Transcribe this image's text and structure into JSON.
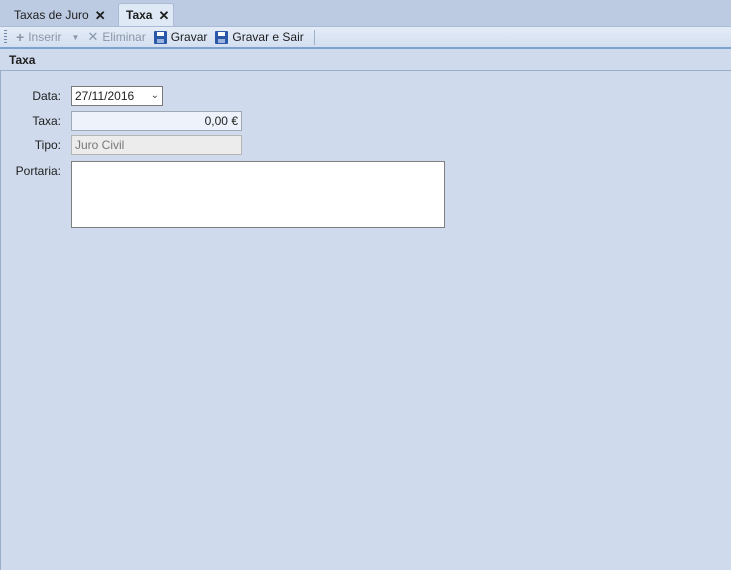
{
  "tabs": [
    {
      "label": "Taxas de Juro",
      "close": "✕"
    },
    {
      "label": "Taxa",
      "close": "✕"
    }
  ],
  "toolbar": {
    "inserir": "Inserir",
    "eliminar": "Eliminar",
    "gravar": "Gravar",
    "gravar_sair": "Gravar e Sair"
  },
  "section": {
    "title": "Taxa"
  },
  "form": {
    "data_label": "Data:",
    "data_value": "27/11/2016",
    "taxa_label": "Taxa:",
    "taxa_value": "0,00 €",
    "tipo_label": "Tipo:",
    "tipo_value": "Juro Civil",
    "portaria_label": "Portaria:",
    "portaria_value": ""
  }
}
